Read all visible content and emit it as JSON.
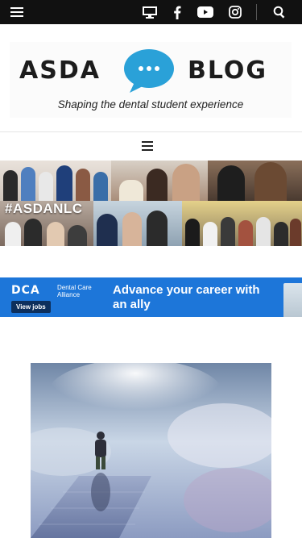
{
  "topbar": {
    "icons": [
      "menu-icon",
      "monitor-icon",
      "facebook-icon",
      "youtube-icon",
      "instagram-icon",
      "search-icon"
    ],
    "background": "#111111"
  },
  "logo": {
    "left_word": "ASDA",
    "right_word": "BLOG",
    "tagline": "Shaping the dental student experience",
    "bubble_color": "#2aa1d8"
  },
  "banner": {
    "hashtag": "#ASDANLC"
  },
  "ad": {
    "logo": "DCA",
    "logo_sub": "Dental Care Alliance",
    "button": "View jobs",
    "headline": "Advance your career with an ally",
    "background": "#1d76d9"
  }
}
